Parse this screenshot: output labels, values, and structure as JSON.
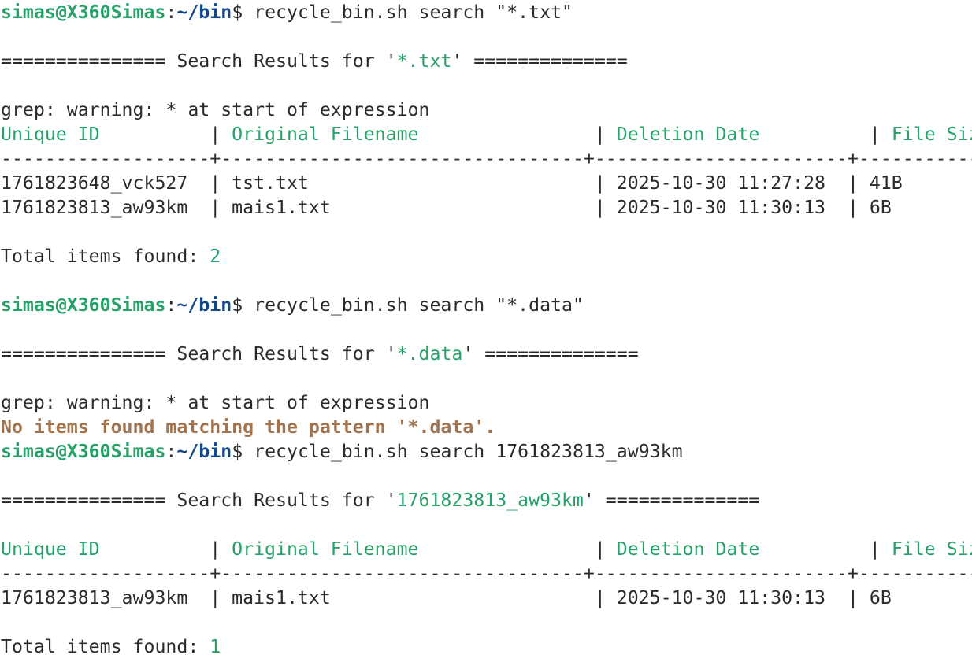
{
  "prompt": {
    "user_host": "simas@X360Simas",
    "colon": ":",
    "path": "~/bin",
    "symbol": "$ "
  },
  "commands": [
    "recycle_bin.sh search \"*.txt\"",
    "recycle_bin.sh search \"*.data\"",
    "recycle_bin.sh search 1761823813_aw93km"
  ],
  "results_prefix": "=============== Search Results for '",
  "results_suffix": "' ==============",
  "patterns": [
    "*.txt",
    "*.data",
    "1761823813_aw93km"
  ],
  "grep_warning": "grep: warning: * at start of expression",
  "table": {
    "headers": [
      "Unique ID",
      "Original Filename",
      "Deletion Date",
      "File Size"
    ],
    "header_sep": "| ",
    "separator": "-------------------+---------------------------------+-----------------------+-----------"
  },
  "rows_1": [
    [
      "1761823648_vck527  ",
      "| tst.txt                          ",
      "| 2025-10-30 11:27:28  ",
      "| 41B"
    ],
    [
      "1761823813_aw93km  ",
      "| mais1.txt                        ",
      "| 2025-10-30 11:30:13  ",
      "| 6B"
    ]
  ],
  "rows_3": [
    [
      "1761823813_aw93km  ",
      "| mais1.txt                        ",
      "| 2025-10-30 11:30:13  ",
      "| 6B"
    ]
  ],
  "total_label": "Total items found: ",
  "totals": [
    "2",
    "1"
  ],
  "no_items": "No items found matching the pattern '*.data'."
}
